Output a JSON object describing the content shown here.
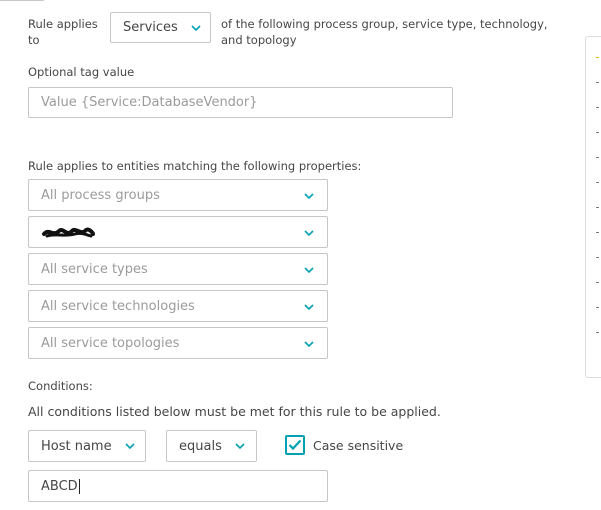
{
  "rule": {
    "applies_label": "Rule applies to",
    "applies_value": "Services",
    "applies_suffix": "of the following process group, service type, technology, and topology"
  },
  "tag": {
    "label": "Optional tag value",
    "placeholder": "Value {Service:DatabaseVendor}"
  },
  "entities": {
    "label": "Rule applies to entities matching the following properties:",
    "process_groups": "All process groups",
    "service_types": "All service types",
    "service_technologies": "All service technologies",
    "service_topologies": "All service topologies"
  },
  "conditions": {
    "label": "Conditions:",
    "description": "All conditions listed below must be met for this rule to be applied.",
    "attribute": "Host name",
    "operator": "equals",
    "case_sensitive_label": "Case sensitive",
    "case_sensitive_checked": true,
    "value": "ABCD"
  },
  "colors": {
    "accent": "#00a1b2",
    "text": "#454646",
    "placeholder": "#9b9b9b",
    "border": "#c6c6c6"
  },
  "icons": {
    "dropdown": "chevron-down-icon",
    "checkbox": "checkmark-icon",
    "redaction": "redacted-scribble"
  }
}
